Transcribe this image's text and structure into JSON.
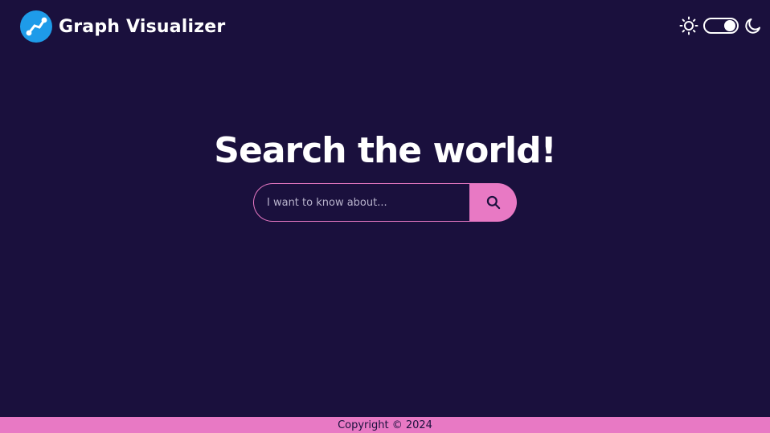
{
  "header": {
    "logo_icon": "graph-line-icon",
    "title": "Graph Visualizer",
    "theme_toggle": {
      "light_icon": "sun-icon",
      "dark_icon": "moon-icon",
      "state": "dark"
    }
  },
  "hero": {
    "title": "Search the world!"
  },
  "search": {
    "placeholder": "I want to know about...",
    "value": "",
    "button_icon": "search-icon"
  },
  "footer": {
    "text": "Copyright © 2024"
  },
  "colors": {
    "background": "#1a103d",
    "accent": "#e879c4",
    "logo": "#1e9be9",
    "text": "#ffffff"
  }
}
